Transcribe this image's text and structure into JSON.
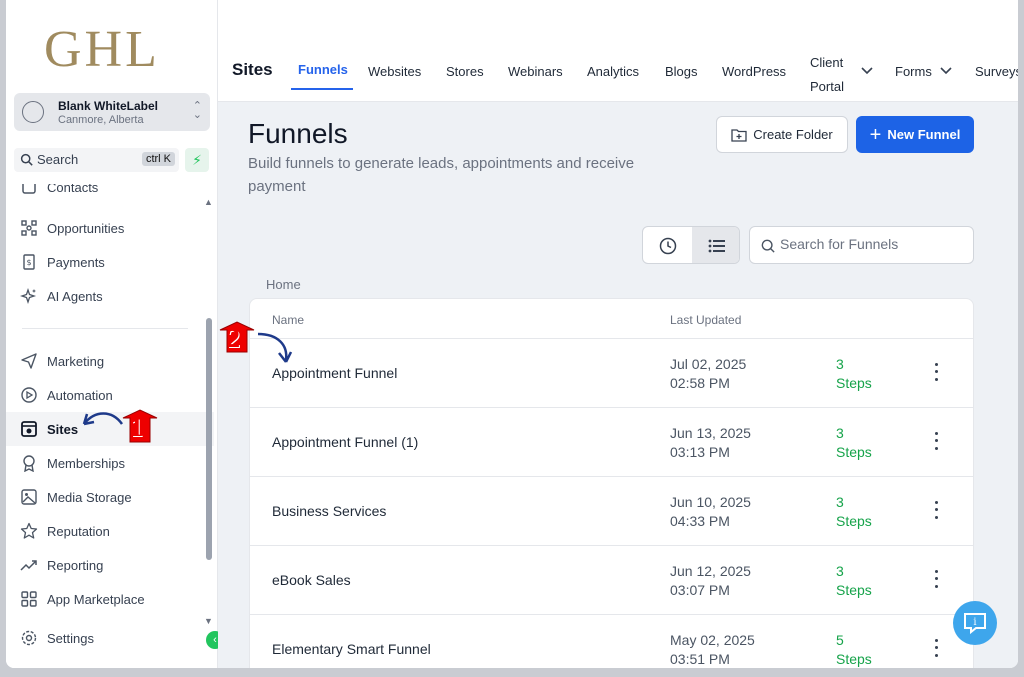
{
  "sidebar": {
    "logo": "GHL",
    "account": {
      "name": "Blank WhiteLabel",
      "location": "Canmore, Alberta"
    },
    "search": {
      "label": "Search",
      "shortcut": "ctrl K"
    },
    "partial_item": "Contacts",
    "items_top": [
      {
        "label": "Opportunities",
        "icon": "opportunities-icon"
      },
      {
        "label": "Payments",
        "icon": "payments-icon"
      },
      {
        "label": "AI Agents",
        "icon": "ai-agents-icon"
      }
    ],
    "items": [
      {
        "label": "Marketing",
        "icon": "send-icon"
      },
      {
        "label": "Automation",
        "icon": "automation-icon"
      },
      {
        "label": "Sites",
        "icon": "sites-icon",
        "active": true
      },
      {
        "label": "Memberships",
        "icon": "memberships-icon"
      },
      {
        "label": "Media Storage",
        "icon": "image-icon"
      },
      {
        "label": "Reputation",
        "icon": "star-icon"
      },
      {
        "label": "Reporting",
        "icon": "trend-icon"
      },
      {
        "label": "App Marketplace",
        "icon": "grid-icon"
      }
    ],
    "settings": "Settings"
  },
  "topbar": {
    "section_title": "Sites",
    "tabs": [
      "Funnels",
      "Websites",
      "Stores",
      "Webinars",
      "Analytics",
      "Blogs",
      "WordPress",
      "Client",
      "Portal",
      "Forms",
      "Surveys"
    ],
    "active_tab": "Funnels",
    "icon_colors": {
      "phone": "#16a34a",
      "magic": "#2563eb",
      "megaphone": "#3f9e6a",
      "bell": "#f97316",
      "help": "#3b82f6"
    }
  },
  "main": {
    "title": "Funnels",
    "subtitle": "Build funnels to generate leads, appointments and receive payment",
    "create_folder": "Create Folder",
    "new_funnel": "New Funnel",
    "search_placeholder": "Search for Funnels",
    "breadcrumb": "Home",
    "columns": {
      "name": "Name",
      "updated": "Last Updated"
    },
    "rows": [
      {
        "name": "Appointment Funnel",
        "date": "Jul 02, 2025",
        "time": "02:58 PM",
        "steps": "3",
        "steps_label": "Steps"
      },
      {
        "name": "Appointment Funnel (1)",
        "date": "Jun 13, 2025",
        "time": "03:13 PM",
        "steps": "3",
        "steps_label": "Steps"
      },
      {
        "name": "Business Services",
        "date": "Jun 10, 2025",
        "time": "04:33 PM",
        "steps": "3",
        "steps_label": "Steps"
      },
      {
        "name": "eBook Sales",
        "date": "Jun 12, 2025",
        "time": "03:07 PM",
        "steps": "3",
        "steps_label": "Steps"
      },
      {
        "name": "Elementary Smart Funnel",
        "date": "May 02, 2025",
        "time": "03:51 PM",
        "steps": "5",
        "steps_label": "Steps"
      }
    ]
  },
  "annotations": {
    "step1": "1",
    "step2": "2"
  }
}
